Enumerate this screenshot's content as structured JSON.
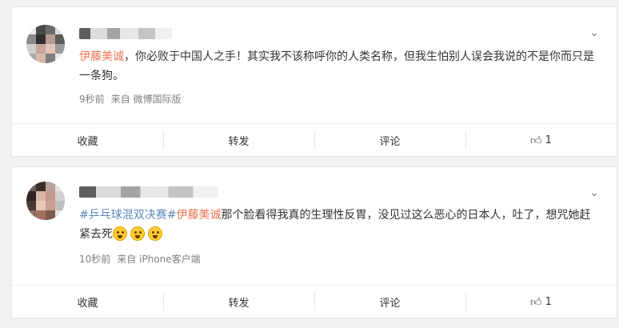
{
  "posts": [
    {
      "mention": "伊藤美诚",
      "text_after": "，你必败于中国人之手！其实我不该称呼你的人类名称，但我生怕别人误会我说的不是你而只是一条狗。",
      "time": "9秒前",
      "source": "来自 微博国际版",
      "actions": {
        "favorite": "收藏",
        "repost": "转发",
        "comment": "评论",
        "like_count": "1"
      }
    },
    {
      "topic": "#乒乓球混双决赛#",
      "mention": "伊藤美诚",
      "text_after": "那个脸看得我真的生理性反胃，没见过这么恶心的日本人，吐了，想咒她赶紧去死",
      "time": "10秒前",
      "source": "来自 iPhone客户端",
      "actions": {
        "favorite": "收藏",
        "repost": "转发",
        "comment": "评论",
        "like_count": "1"
      }
    }
  ],
  "icons": {
    "chevron": "chevron-down-icon",
    "like": "thumbs-up-icon",
    "emoji": "scream-emoji-icon"
  }
}
